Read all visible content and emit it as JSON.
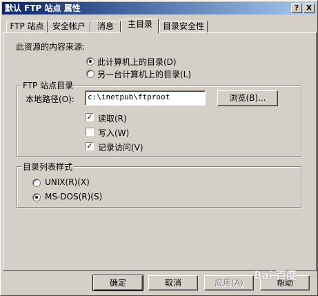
{
  "window": {
    "title": "默认 FTP 站点 属性"
  },
  "titlebar_buttons": {
    "help": "?",
    "close": "X"
  },
  "tabs": [
    {
      "label": "FTP 站点"
    },
    {
      "label": "安全帐户"
    },
    {
      "label": "消息"
    },
    {
      "label": "主目录"
    },
    {
      "label": "目录安全性"
    }
  ],
  "content_source": {
    "label": "此资源的内容来源:",
    "options": [
      {
        "label": "此计算机上的目录(D)",
        "selected": true
      },
      {
        "label": "另一台计算机上的目录(L)",
        "selected": false
      }
    ]
  },
  "ftp_dir": {
    "group_title": "FTP 站点目录",
    "local_path_label": "本地路径(O):",
    "local_path_value": "c:\\inetpub\\ftproot",
    "browse_label": "浏览(B)...",
    "permissions": [
      {
        "label": "读取(R)",
        "checked": true
      },
      {
        "label": "写入(W)",
        "checked": false
      },
      {
        "label": "记录访问(V)",
        "checked": true
      }
    ]
  },
  "listing_style": {
    "group_title": "目录列表样式",
    "options": [
      {
        "label": "UNIX(R)(X)",
        "selected": false
      },
      {
        "label": "MS-DOS(R)(S)",
        "selected": true
      }
    ]
  },
  "footer": {
    "ok": "确定",
    "cancel": "取消",
    "apply": "应用(A)",
    "help": "帮助"
  },
  "watermark": {
    "text": "Bai 百度"
  }
}
